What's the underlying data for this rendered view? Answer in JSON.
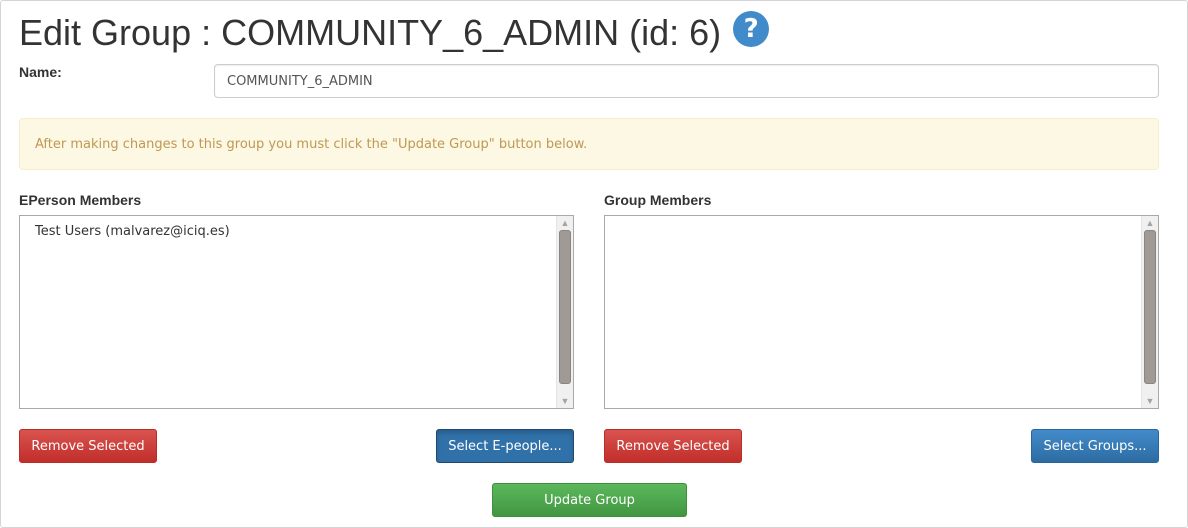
{
  "header": {
    "title": "Edit Group : COMMUNITY_6_ADMIN (id: 6)",
    "help_icon": "question-circle-icon",
    "help_glyph": "?"
  },
  "name_field": {
    "label": "Name:",
    "value": "COMMUNITY_6_ADMIN"
  },
  "alert": {
    "text": "After making changes to this group you must click the \"Update Group\" button below."
  },
  "eperson_members": {
    "label": "EPerson Members",
    "items": [
      "Test Users (malvarez@iciq.es)"
    ],
    "remove_label": "Remove Selected",
    "select_label": "Select E-people..."
  },
  "group_members": {
    "label": "Group Members",
    "items": [],
    "remove_label": "Remove Selected",
    "select_label": "Select Groups..."
  },
  "update_button": {
    "label": "Update Group"
  },
  "colors": {
    "primary": "#428bca",
    "danger": "#d9534f",
    "success": "#5cb85c",
    "warning_bg": "#fcf8e3",
    "warning_text": "#c09853"
  }
}
